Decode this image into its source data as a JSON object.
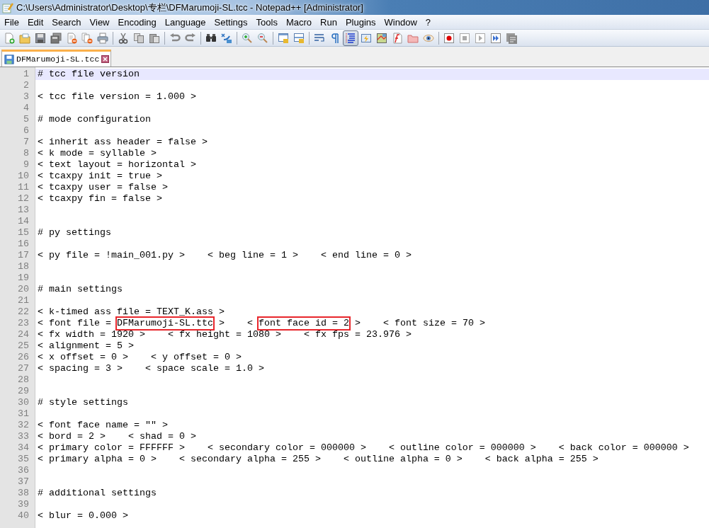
{
  "window": {
    "title": "C:\\Users\\Administrator\\Desktop\\专栏\\DFMarumoji-SL.tcc - Notepad++ [Administrator]"
  },
  "menu": [
    "File",
    "Edit",
    "Search",
    "View",
    "Encoding",
    "Language",
    "Settings",
    "Tools",
    "Macro",
    "Run",
    "Plugins",
    "Window",
    "?"
  ],
  "toolbar": [
    {
      "kind": "new",
      "pressed": false
    },
    {
      "kind": "open",
      "pressed": false
    },
    {
      "kind": "save",
      "pressed": false
    },
    {
      "kind": "save-all",
      "pressed": false
    },
    {
      "kind": "close",
      "pressed": false
    },
    {
      "kind": "close-all",
      "pressed": false
    },
    {
      "kind": "print",
      "pressed": false
    },
    {
      "kind": "separator"
    },
    {
      "kind": "cut",
      "pressed": false
    },
    {
      "kind": "copy",
      "pressed": false
    },
    {
      "kind": "paste",
      "pressed": false
    },
    {
      "kind": "separator"
    },
    {
      "kind": "undo",
      "pressed": false
    },
    {
      "kind": "redo",
      "pressed": false
    },
    {
      "kind": "separator"
    },
    {
      "kind": "find",
      "pressed": false
    },
    {
      "kind": "replace",
      "pressed": false
    },
    {
      "kind": "separator"
    },
    {
      "kind": "zoom-in",
      "pressed": false
    },
    {
      "kind": "zoom-out",
      "pressed": false
    },
    {
      "kind": "separator"
    },
    {
      "kind": "sync-v",
      "pressed": false
    },
    {
      "kind": "sync-h",
      "pressed": false
    },
    {
      "kind": "separator"
    },
    {
      "kind": "wrap",
      "pressed": false
    },
    {
      "kind": "all-chars",
      "pressed": false
    },
    {
      "kind": "indent",
      "pressed": true
    },
    {
      "kind": "udl",
      "pressed": false
    },
    {
      "kind": "doc-map",
      "pressed": false
    },
    {
      "kind": "func",
      "pressed": false
    },
    {
      "kind": "folder",
      "pressed": false
    },
    {
      "kind": "monitor",
      "pressed": false
    },
    {
      "kind": "separator"
    },
    {
      "kind": "record",
      "pressed": false
    },
    {
      "kind": "stop",
      "pressed": false
    },
    {
      "kind": "play",
      "pressed": false
    },
    {
      "kind": "play-multi",
      "pressed": false
    },
    {
      "kind": "save-macro",
      "pressed": false
    }
  ],
  "tabs": [
    {
      "label": "DFMarumoji-SL.tcc",
      "selected": true
    }
  ],
  "editor": {
    "lines": [
      {
        "number": "1",
        "current": true,
        "text": "# tcc file version"
      },
      {
        "number": "2",
        "current": false
      },
      {
        "number": "3",
        "current": false,
        "text": "< tcc file version = 1.000 >"
      },
      {
        "number": "4",
        "current": false
      },
      {
        "number": "5",
        "current": false,
        "text": "# mode configuration"
      },
      {
        "number": "6",
        "current": false
      },
      {
        "number": "7",
        "current": false,
        "text": "< inherit ass header = false >"
      },
      {
        "number": "8",
        "current": false,
        "text": "< k mode = syllable >"
      },
      {
        "number": "9",
        "current": false,
        "text": "< text layout = horizontal >"
      },
      {
        "number": "10",
        "current": false,
        "text": "< tcaxpy init = true >"
      },
      {
        "number": "11",
        "current": false,
        "text": "< tcaxpy user = false >"
      },
      {
        "number": "12",
        "current": false,
        "text": "< tcaxpy fin = false >"
      },
      {
        "number": "13",
        "current": false
      },
      {
        "number": "14",
        "current": false
      },
      {
        "number": "15",
        "current": false,
        "text": "# py settings"
      },
      {
        "number": "16",
        "current": false
      },
      {
        "number": "17",
        "current": false,
        "text": "< py file = !main_001.py >    < beg line = 1 >    < end line = 0 >"
      },
      {
        "number": "18",
        "current": false
      },
      {
        "number": "19",
        "current": false
      },
      {
        "number": "20",
        "current": false,
        "text": "# main settings"
      },
      {
        "number": "21",
        "current": false
      },
      {
        "number": "22",
        "current": false,
        "text": "< k-timed ass file = TEXT_K.ass >"
      },
      {
        "number": "23",
        "current": false,
        "segments": [
          {
            "text": "< font file = ",
            "highlighted": false
          },
          {
            "text": "DFMarumoji-SL.ttc",
            "highlighted": true
          },
          {
            "text": " >    < ",
            "highlighted": false
          },
          {
            "text": "font face id = 2",
            "highlighted": true
          },
          {
            "text": " >    < font size = 70 >",
            "highlighted": false
          }
        ]
      },
      {
        "number": "24",
        "current": false,
        "text": "< fx width = 1920 >    < fx height = 1080 >    < fx fps = 23.976 >"
      },
      {
        "number": "25",
        "current": false,
        "text": "< alignment = 5 >"
      },
      {
        "number": "26",
        "current": false,
        "text": "< x offset = 0 >    < y offset = 0 >"
      },
      {
        "number": "27",
        "current": false,
        "text": "< spacing = 3 >    < space scale = 1.0 >"
      },
      {
        "number": "28",
        "current": false
      },
      {
        "number": "29",
        "current": false
      },
      {
        "number": "30",
        "current": false,
        "text": "# style settings"
      },
      {
        "number": "31",
        "current": false
      },
      {
        "number": "32",
        "current": false,
        "text": "< font face name = \"\" >"
      },
      {
        "number": "33",
        "current": false,
        "text": "< bord = 2 >    < shad = 0 >"
      },
      {
        "number": "34",
        "current": false,
        "text": "< primary color = FFFFFF >    < secondary color = 000000 >    < outline color = 000000 >    < back color = 000000 >"
      },
      {
        "number": "35",
        "current": false,
        "text": "< primary alpha = 0 >    < secondary alpha = 255 >    < outline alpha = 0 >    < back alpha = 255 >"
      },
      {
        "number": "36",
        "current": false
      },
      {
        "number": "37",
        "current": false
      },
      {
        "number": "38",
        "current": false,
        "text": "# additional settings"
      },
      {
        "number": "39",
        "current": false
      },
      {
        "number": "40",
        "current": false,
        "text": "< blur = 0.000 >"
      }
    ]
  }
}
